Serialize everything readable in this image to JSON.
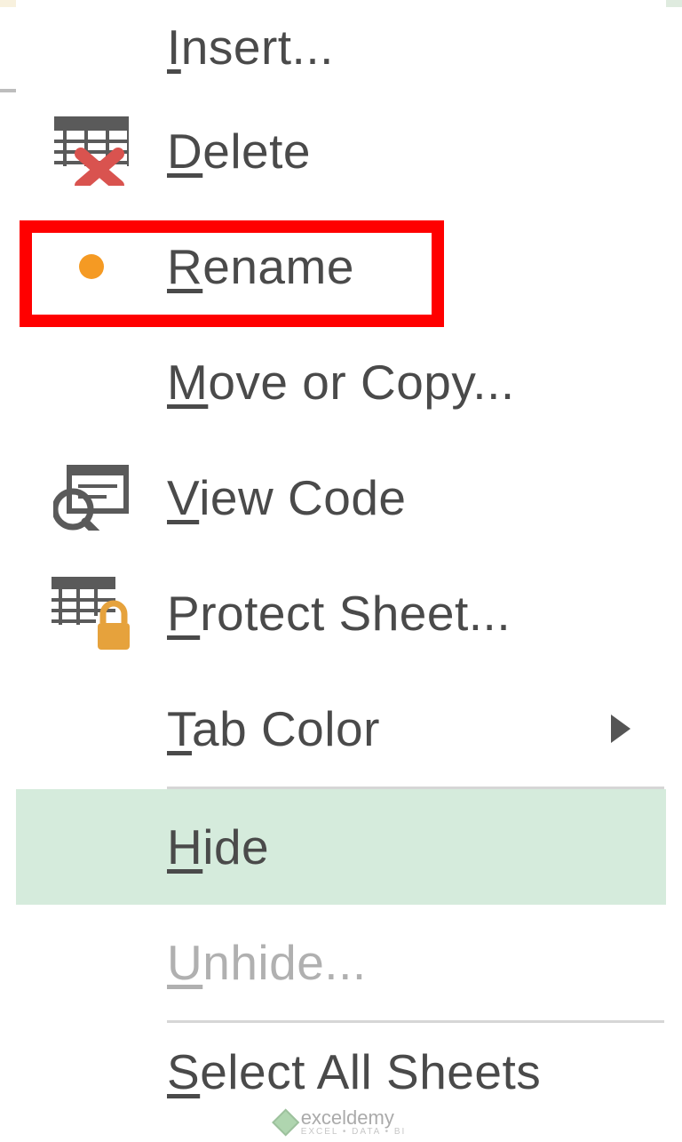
{
  "menu": {
    "insert": {
      "pre": "",
      "accel": "I",
      "post": "nsert..."
    },
    "delete": {
      "pre": "",
      "accel": "D",
      "post": "elete"
    },
    "rename": {
      "pre": "",
      "accel": "R",
      "post": "ename"
    },
    "move_or_copy": {
      "pre": "",
      "accel": "M",
      "post": "ove or Copy..."
    },
    "view_code": {
      "pre": "",
      "accel": "V",
      "post": "iew Code"
    },
    "protect_sheet": {
      "pre": "",
      "accel": "P",
      "post": "rotect Sheet..."
    },
    "tab_color": {
      "pre": "",
      "accel": "T",
      "post": "ab Color"
    },
    "hide": {
      "pre": "",
      "accel": "H",
      "post": "ide"
    },
    "unhide": {
      "pre": "",
      "accel": "U",
      "post": "nhide..."
    },
    "select_all": {
      "pre": "",
      "accel": "S",
      "post": "elect All Sheets"
    }
  },
  "watermark": {
    "brand": "exceldemy",
    "tagline": "EXCEL • DATA • BI"
  }
}
